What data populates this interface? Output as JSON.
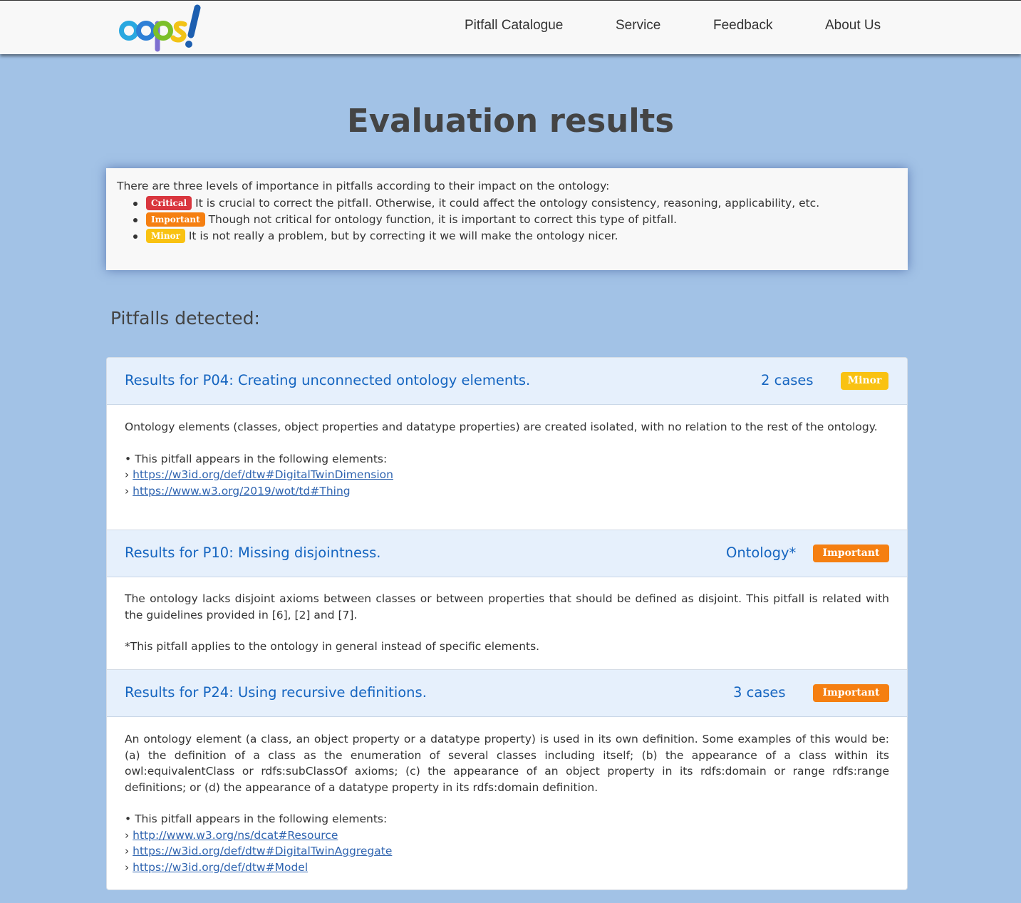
{
  "nav": {
    "links": [
      "Pitfall Catalogue",
      "Service",
      "Feedback",
      "About Us"
    ]
  },
  "logo": {
    "text": "oops!"
  },
  "page_title": "Evaluation results",
  "legend": {
    "intro": "There are three levels of importance in pitfalls according to their impact on the ontology:",
    "items": [
      {
        "badge": "Critical",
        "text": "It is crucial to correct the pitfall. Otherwise, it could affect the ontology consistency, reasoning, applicability, etc."
      },
      {
        "badge": "Important",
        "text": "Though not critical for ontology function, it is important to correct this type of pitfall."
      },
      {
        "badge": "Minor",
        "text": "It is not really a problem, but by correcting it we will make the ontology nicer."
      }
    ]
  },
  "pitfalls_heading": "Pitfalls detected:",
  "results": [
    {
      "title": "Results for P04: Creating unconnected ontology elements.",
      "count": "2 cases",
      "badge": "Minor",
      "description": "Ontology elements (classes, object properties and datatype properties) are created isolated, with no relation to the rest of the ontology.",
      "appears": "• This pitfall appears in the following elements:",
      "elements": [
        "https://w3id.org/def/dtw#DigitalTwinDimension",
        "https://www.w3.org/2019/wot/td#Thing"
      ]
    },
    {
      "title": "Results for P10: Missing disjointness.",
      "count": "Ontology*",
      "badge": "Important",
      "description": "The ontology lacks disjoint axioms between classes or between properties that should be defined as disjoint. This pitfall is related with the guidelines provided in [6], [2] and [7].",
      "note": "*This pitfall applies to the ontology in general instead of specific elements."
    },
    {
      "title": "Results for P24: Using recursive definitions.",
      "count": "3 cases",
      "badge": "Important",
      "description": "An ontology element (a class, an object property or a datatype property) is used in its own definition. Some examples of this would be: (a) the definition of a class as the enumeration of several classes including itself; (b) the appearance of a class within its owl:equivalentClass or rdfs:subClassOf axioms; (c) the appearance of an object property in its rdfs:domain or range rdfs:range definitions; or (d) the appearance of a datatype property in its rdfs:domain definition.",
      "appears": "• This pitfall appears in the following elements:",
      "elements": [
        "http://www.w3.org/ns/dcat#Resource",
        "https://w3id.org/def/dtw#DigitalTwinAggregate",
        "https://w3id.org/def/dtw#Model"
      ]
    }
  ],
  "colors": {
    "critical": "#d9363e",
    "important": "#f57f11",
    "minor": "#f9c212",
    "link": "#1565c0",
    "background": "#a2c2e6"
  }
}
